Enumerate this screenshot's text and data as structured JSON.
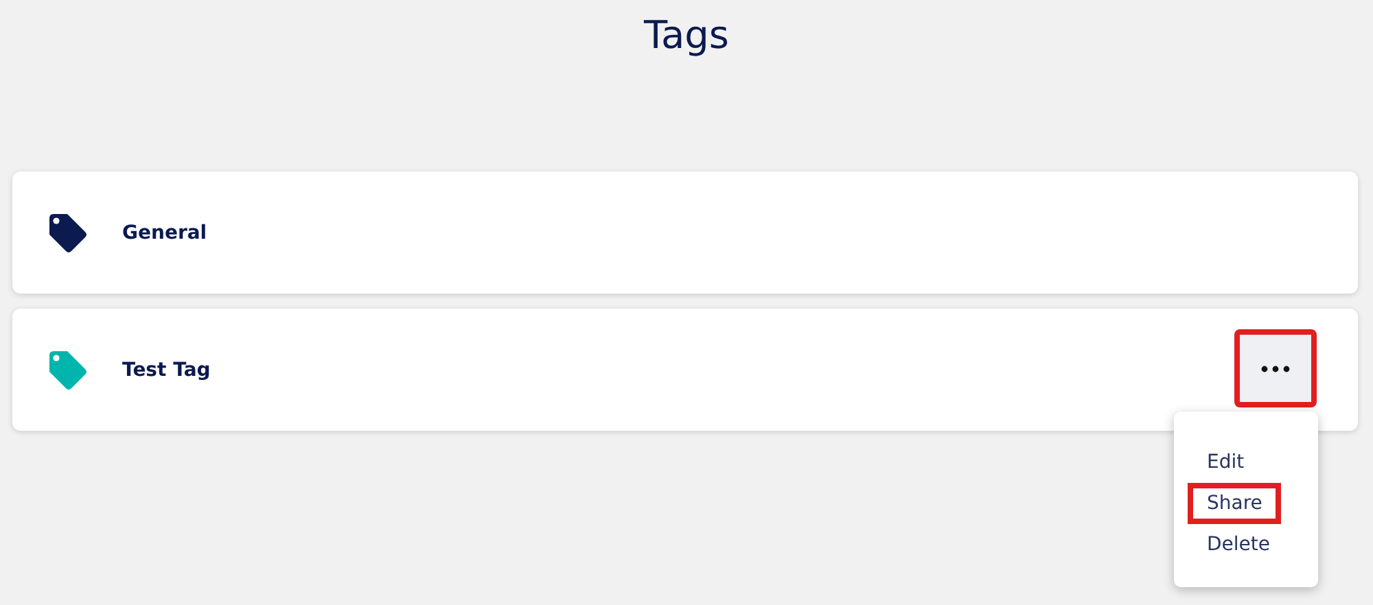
{
  "title": "Tags",
  "tags": [
    {
      "name": "General",
      "color": "#0b1a4f",
      "menu_open": false
    },
    {
      "name": "Test Tag",
      "color": "#00b5ad",
      "menu_open": true,
      "more_highlighted": true
    }
  ],
  "menu": [
    {
      "label": "Edit",
      "highlighted": false
    },
    {
      "label": "Share",
      "highlighted": true
    },
    {
      "label": "Delete",
      "highlighted": false
    }
  ]
}
